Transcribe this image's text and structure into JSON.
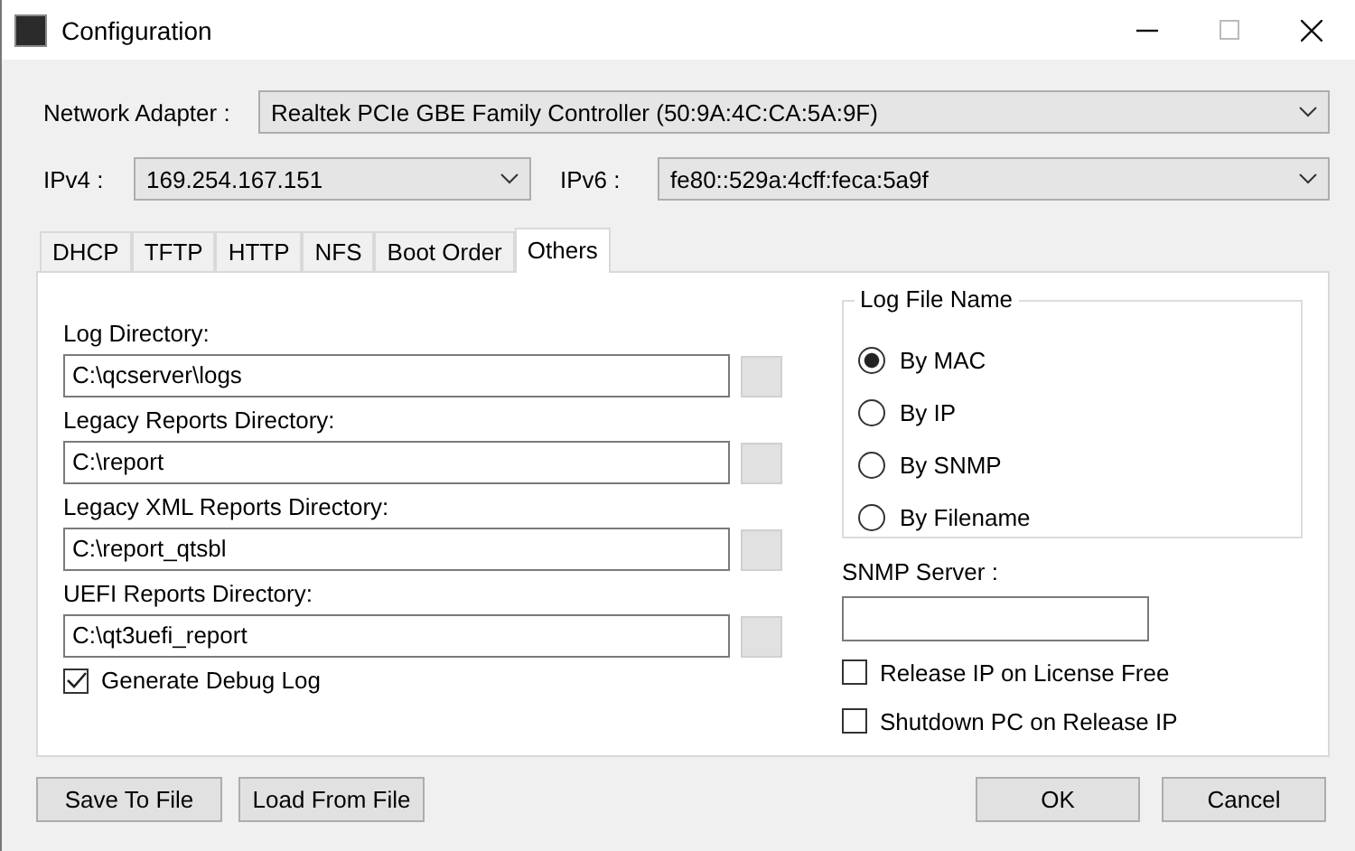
{
  "window": {
    "title": "Configuration"
  },
  "network_adapter": {
    "label": "Network Adapter :",
    "value": "Realtek PCIe GBE Family Controller (50:9A:4C:CA:5A:9F)"
  },
  "ipv4": {
    "label": "IPv4 :",
    "value": "169.254.167.151"
  },
  "ipv6": {
    "label": "IPv6 :",
    "value": "fe80::529a:4cff:feca:5a9f"
  },
  "tabs": [
    {
      "label": "DHCP",
      "selected": false
    },
    {
      "label": "TFTP",
      "selected": false
    },
    {
      "label": "HTTP",
      "selected": false
    },
    {
      "label": "NFS",
      "selected": false
    },
    {
      "label": "Boot Order",
      "selected": false
    },
    {
      "label": "Others",
      "selected": true
    }
  ],
  "directories": [
    {
      "label": "Log Directory:",
      "value": "C:\\qcserver\\logs"
    },
    {
      "label": "Legacy Reports Directory:",
      "value": "C:\\report"
    },
    {
      "label": "Legacy XML Reports Directory:",
      "value": "C:\\report_qtsbl"
    },
    {
      "label": "UEFI Reports Directory:",
      "value": "C:\\qt3uefi_report"
    }
  ],
  "generate_debug_log": {
    "label": "Generate Debug Log",
    "checked": true
  },
  "log_file_name": {
    "title": "Log File Name",
    "options": [
      {
        "label": "By MAC",
        "selected": true
      },
      {
        "label": "By IP",
        "selected": false
      },
      {
        "label": "By SNMP",
        "selected": false
      },
      {
        "label": "By Filename",
        "selected": false
      }
    ]
  },
  "snmp_server": {
    "label": "SNMP Server :"
  },
  "release_options": [
    {
      "label": "Release IP on License Free",
      "checked": false
    },
    {
      "label": "Shutdown PC on Release IP",
      "checked": false
    }
  ],
  "left_buttons": [
    "Save To File",
    "Load From File"
  ],
  "right_buttons": [
    "OK",
    "Cancel"
  ]
}
